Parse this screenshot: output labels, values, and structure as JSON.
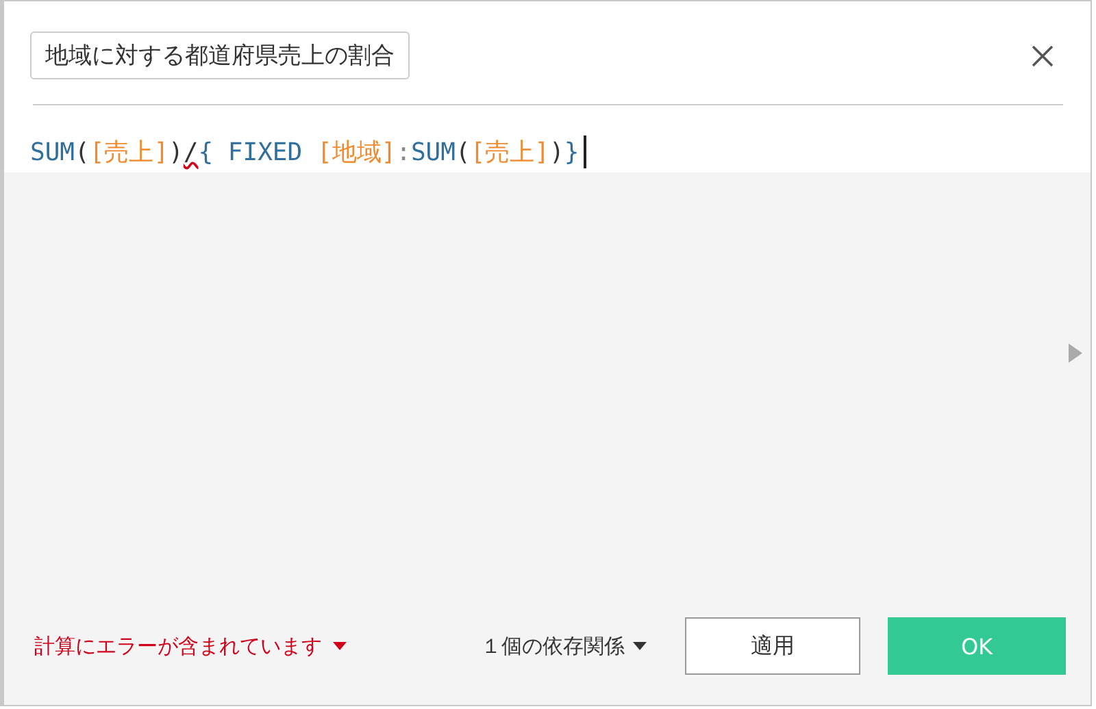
{
  "dialog": {
    "name_field": {
      "value": "地域に対する都道府県売上の割合"
    }
  },
  "formula": [
    {
      "text": "SUM",
      "kind": "function",
      "error": false
    },
    {
      "text": "(",
      "kind": "punct",
      "error": false
    },
    {
      "text": "[売上]",
      "kind": "field",
      "error": false
    },
    {
      "text": ")",
      "kind": "punct",
      "error": false
    },
    {
      "text": "/",
      "kind": "punct",
      "error": true
    },
    {
      "text": "{ FIXED ",
      "kind": "function",
      "error": false
    },
    {
      "text": "[地域]",
      "kind": "field",
      "error": false
    },
    {
      "text": ":",
      "kind": "colon",
      "error": false
    },
    {
      "text": "SUM",
      "kind": "function",
      "error": false
    },
    {
      "text": "(",
      "kind": "punct",
      "error": false
    },
    {
      "text": "[売上]",
      "kind": "field",
      "error": false
    },
    {
      "text": ")",
      "kind": "punct",
      "error": false
    },
    {
      "text": "}",
      "kind": "function",
      "error": false
    }
  ],
  "footer": {
    "error_message": "計算にエラーが含まれています",
    "dependencies": "１個の依存関係",
    "buttons": [
      {
        "label": "適用",
        "kind": "secondary"
      },
      {
        "label": "OK",
        "kind": "primary"
      }
    ]
  }
}
